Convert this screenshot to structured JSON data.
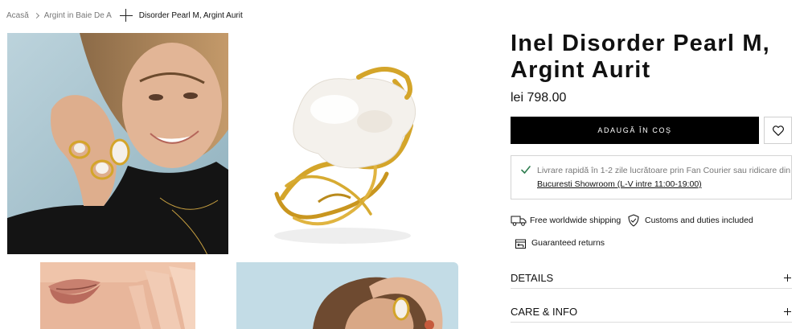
{
  "breadcrumb": {
    "home": "Acasă",
    "category": "Argint in Baie De Aur",
    "current": "Disorder Pearl M, Argint Aurit"
  },
  "product": {
    "title": "Inel Disorder Pearl M, Argint Aurit",
    "price": "lei 798.00",
    "add_to_cart_label": "ADAUGĂ ÎN COȘ"
  },
  "delivery": {
    "line1": "Livrare rapidă în 1-2 zile lucrătoare prin Fan Courier sau ridicare din",
    "line2": "Bucuresti Showroom (L-V intre 11:00-19:00)"
  },
  "features": {
    "shipping": "Free worldwide shipping",
    "customs": "Customs and duties included",
    "returns": "Guaranteed returns"
  },
  "accordion": {
    "details": "DETAILS",
    "care": "CARE & INFO"
  },
  "icons": {
    "wishlist": "heart-icon",
    "delivery_check": "check-icon",
    "shipping": "truck-icon",
    "customs": "shield-check-icon",
    "returns": "box-return-icon"
  },
  "colors": {
    "button_bg": "#000000",
    "check_green": "#2e7d4f",
    "gold": "#d4a52a"
  }
}
